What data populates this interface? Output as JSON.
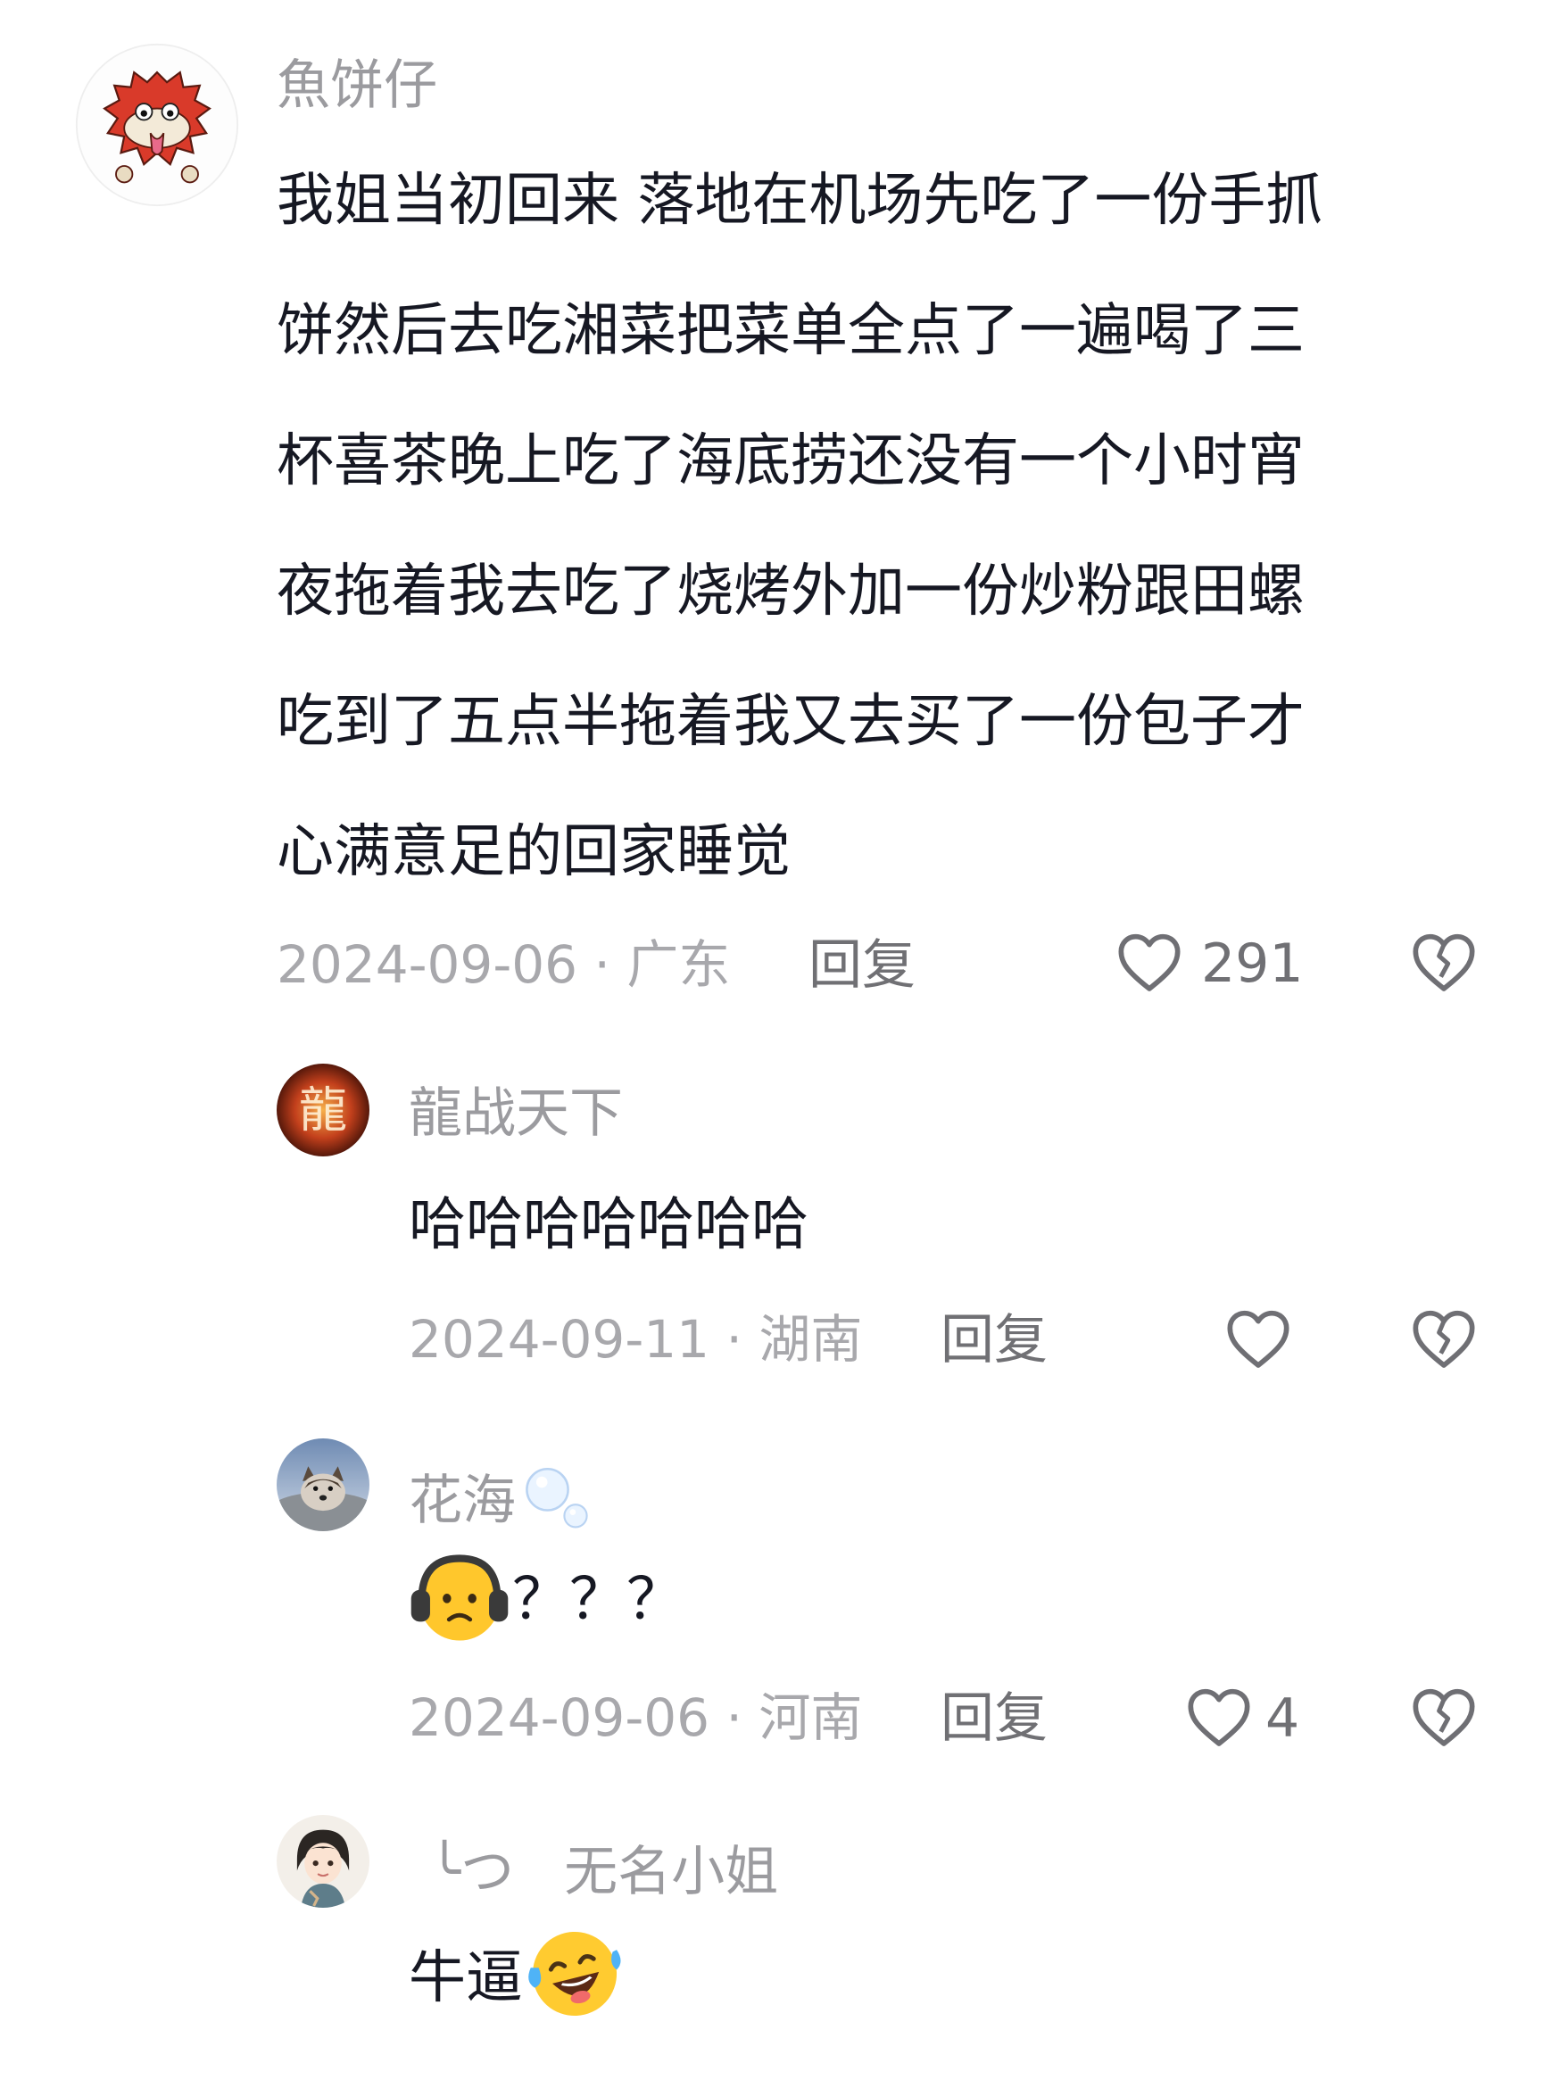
{
  "comments": [
    {
      "username": "魚饼仔",
      "content_lines": [
        "我姐当初回来 落地在机场先吃了一份手抓",
        "饼然后去吃湘菜把菜单全点了一遍喝了三",
        "杯喜茶晚上吃了海底捞还没有一个小时宵",
        "夜拖着我去吃了烧烤外加一份炒粉跟田螺",
        "吃到了五点半拖着我又去买了一份包子才",
        "心满意足的回家睡觉"
      ],
      "date": "2024-09-06",
      "separator": " · ",
      "location": "广东",
      "reply_label": "回复",
      "likes": "291"
    },
    {
      "username": "龍战天下",
      "content": "哈哈哈哈哈哈哈",
      "date": "2024-09-11",
      "separator": " · ",
      "location": "湖南",
      "reply_label": "回复",
      "likes": ""
    },
    {
      "username": "花海",
      "content": "？？？",
      "emoji": "headphone-sad-face-emoji",
      "date": "2024-09-06",
      "separator": " · ",
      "location": "河南",
      "reply_label": "回复",
      "likes": "4"
    },
    {
      "username_prefix": "╰つ",
      "username": "无名小姐",
      "content": "牛逼",
      "emoji": "laughing-crying-emoji"
    }
  ],
  "colors": {
    "text": "#161823",
    "username": "#9b9b9f",
    "meta": "#a8a8ac",
    "action": "#707074"
  }
}
